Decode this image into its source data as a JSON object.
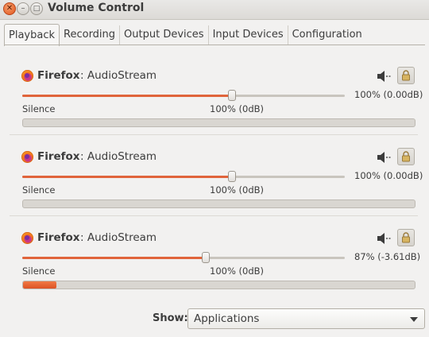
{
  "window": {
    "title": "Volume Control"
  },
  "tabs": [
    {
      "label": "Playback",
      "active": true
    },
    {
      "label": "Recording",
      "active": false
    },
    {
      "label": "Output Devices",
      "active": false
    },
    {
      "label": "Input Devices",
      "active": false
    },
    {
      "label": "Configuration",
      "active": false
    }
  ],
  "streams": [
    {
      "app": "Firefox",
      "stream": ": AudioStream",
      "volume_text": "100% (0.00dB)",
      "volume_fraction": 0.65,
      "level_fraction": 0.0,
      "silence_label": "Silence",
      "tick_label": "100% (0dB)"
    },
    {
      "app": "Firefox",
      "stream": ": AudioStream",
      "volume_text": "100% (0.00dB)",
      "volume_fraction": 0.65,
      "level_fraction": 0.0,
      "silence_label": "Silence",
      "tick_label": "100% (0dB)"
    },
    {
      "app": "Firefox",
      "stream": ": AudioStream",
      "volume_text": "87% (-3.61dB)",
      "volume_fraction": 0.57,
      "level_fraction": 0.085,
      "silence_label": "Silence",
      "tick_label": "100% (0dB)"
    }
  ],
  "footer": {
    "show_label": "Show:",
    "show_value": "Applications"
  },
  "icons": {
    "close": "close-icon",
    "minimize": "minimize-icon",
    "maximize": "maximize-icon",
    "app": "firefox-icon",
    "mute": "speaker-icon",
    "lock": "lock-icon",
    "dropdown": "chevron-down-icon"
  },
  "colors": {
    "accent": "#e0643b",
    "level": "#dd5223",
    "close_button": "#e2561d"
  }
}
